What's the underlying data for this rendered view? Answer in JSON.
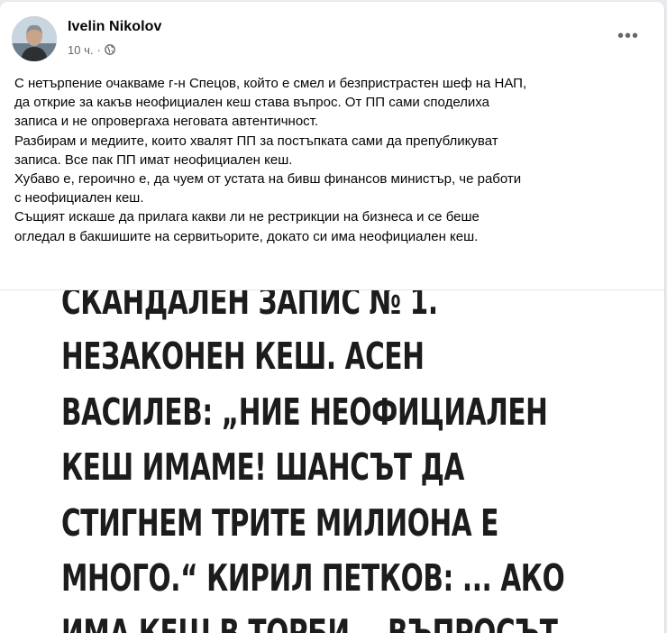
{
  "post": {
    "author": "Ivelin Nikolov",
    "time": "10 ч.",
    "separator": "·",
    "privacy_icon": "globe-icon",
    "more_icon": "more-options-icon",
    "more_label": "•••",
    "paragraphs": [
      "С нетърпение очакваме г-н Спецов, който е смел и безпристрастен шеф на НАП,",
      "да открие за какъв неофициален кеш става въпрос. От ПП сами споделиха",
      "записа и не опровергаха неговата автентичност.",
      "Разбирам и медиите, които хвалят ПП за постъпката сами да препубликуват",
      "записа. Все пак ПП имат неофициален кеш.",
      "Хубаво е, героично е, да чуем от устата на бивш финансов министър, че работи",
      "с неофициален кеш.",
      "Същият искаше да прилага какви ли не рестрикции на бизнеса и се беше",
      "огледал в бакшишите на сервитьорите, докато си има неофициален кеш."
    ]
  },
  "image": {
    "lines": [
      "СКАНДАЛЕН ЗАПИС № 1.",
      "НЕЗАКОНЕН КЕШ. АСЕН",
      "ВАСИЛЕВ: „НИЕ НЕОФИЦИАЛЕН",
      "КЕШ ИМАМЕ!  ШАНСЪТ ДА",
      "СТИГНЕМ ТРИТЕ МИЛИОНА Е",
      "МНОГО.“ КИРИЛ ПЕТКОВ: ... АКО",
      "ИМА КЕШ В ТОРБИ... ВЪПРОСЪТ"
    ]
  },
  "colors": {
    "text": "#050505",
    "meta": "#65676b",
    "background": "#e9ebee"
  }
}
